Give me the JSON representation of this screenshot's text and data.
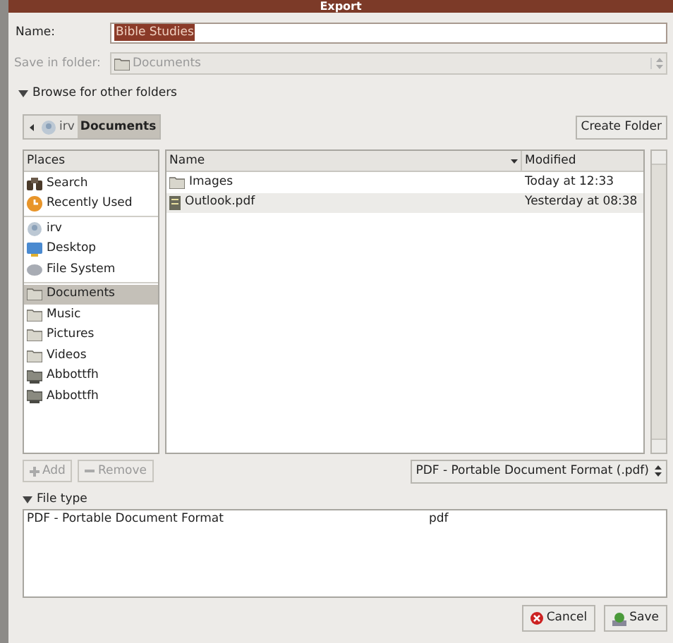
{
  "window": {
    "title": "Export"
  },
  "name_field": {
    "label": "Name:",
    "value": "Bible Studies"
  },
  "save_in": {
    "label": "Save in folder:",
    "value": "Documents",
    "disabled": true
  },
  "browse_toggle": {
    "label": "Browse for other folders",
    "expanded": true
  },
  "path_bar": [
    {
      "label": "irv",
      "kind": "home",
      "selected": false
    },
    {
      "label": "Documents",
      "selected": true
    }
  ],
  "create_folder": "Create Folder",
  "places": {
    "header": "Places",
    "sections": [
      [
        {
          "label": "Search",
          "kind": "search",
          "selected": false
        },
        {
          "label": "Recently Used",
          "kind": "recent",
          "selected": false
        }
      ],
      [
        {
          "label": "irv",
          "kind": "home",
          "selected": false
        },
        {
          "label": "Desktop",
          "kind": "desktop",
          "selected": false
        },
        {
          "label": "File System",
          "kind": "drive",
          "selected": false
        }
      ],
      [
        {
          "label": "Documents",
          "kind": "folder",
          "selected": true
        },
        {
          "label": "Music",
          "kind": "folder",
          "selected": false
        },
        {
          "label": "Pictures",
          "kind": "folder",
          "selected": false
        },
        {
          "label": "Videos",
          "kind": "folder",
          "selected": false
        },
        {
          "label": "Abbottfh",
          "kind": "network",
          "selected": false
        },
        {
          "label": "Abbottfh",
          "kind": "network",
          "selected": false
        }
      ]
    ]
  },
  "files": {
    "columns": [
      "Name",
      "Modified"
    ],
    "rows": [
      {
        "name": "Images",
        "kind": "folder",
        "modified": "Today at 12:33",
        "selected": false
      },
      {
        "name": "Outlook.pdf",
        "kind": "pdf",
        "modified": "Yesterday at 08:38",
        "selected": true
      }
    ]
  },
  "add_button": {
    "label": "Add",
    "disabled": true
  },
  "remove_button": {
    "label": "Remove",
    "disabled": true
  },
  "filter": "PDF - Portable Document Format (.pdf)",
  "file_type": {
    "label": "File type",
    "expanded": true,
    "rows": [
      {
        "name": "PDF - Portable Document Format",
        "extension": "pdf"
      }
    ]
  },
  "buttons": [
    {
      "label": "Cancel",
      "kind": "cancel"
    },
    {
      "label": "Save",
      "kind": "save"
    }
  ]
}
